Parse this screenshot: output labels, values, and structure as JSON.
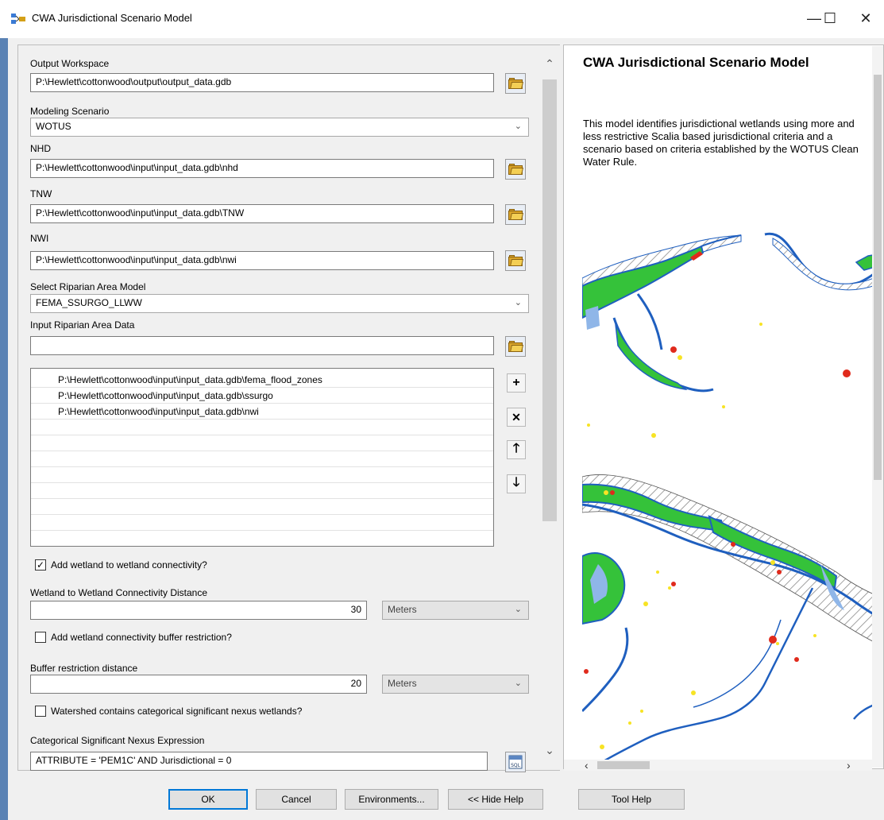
{
  "window": {
    "title": "CWA Jurisdictional Scenario Model",
    "controls": {
      "minimize": "—",
      "maximize": "☐",
      "close": "✕"
    }
  },
  "form": {
    "output_workspace": {
      "label": "Output Workspace",
      "value": "P:\\Hewlett\\cottonwood\\output\\output_data.gdb"
    },
    "modeling_scenario": {
      "label": "Modeling Scenario",
      "value": "WOTUS"
    },
    "nhd": {
      "label": "NHD",
      "value": "P:\\Hewlett\\cottonwood\\input\\input_data.gdb\\nhd"
    },
    "tnw": {
      "label": "TNW",
      "value": "P:\\Hewlett\\cottonwood\\input\\input_data.gdb\\TNW"
    },
    "nwi": {
      "label": "NWI",
      "value": "P:\\Hewlett\\cottonwood\\input\\input_data.gdb\\nwi"
    },
    "riparian_model": {
      "label": "Select Riparian Area Model",
      "value": "FEMA_SSURGO_LLWW"
    },
    "riparian_data": {
      "label": "Input Riparian Area Data",
      "value": "",
      "items": [
        "P:\\Hewlett\\cottonwood\\input\\input_data.gdb\\fema_flood_zones",
        "P:\\Hewlett\\cottonwood\\input\\input_data.gdb\\ssurgo",
        "P:\\Hewlett\\cottonwood\\input\\input_data.gdb\\nwi"
      ]
    },
    "wetland_connectivity": {
      "label": "Add wetland to wetland connectivity?",
      "checked": true
    },
    "connectivity_distance": {
      "label": "Wetland to Wetland Connectivity Distance",
      "value": "30",
      "unit": "Meters"
    },
    "buffer_restriction": {
      "label": "Add wetland connectivity buffer restriction?",
      "checked": false
    },
    "buffer_distance": {
      "label": "Buffer restriction distance",
      "value": "20",
      "unit": "Meters"
    },
    "categorical_wetlands": {
      "label": "Watershed contains categorical significant nexus wetlands?",
      "checked": false
    },
    "nexus_expression": {
      "label": "Categorical Significant Nexus Expression",
      "value": "ATTRIBUTE = 'PEM1C' AND Jurisdictional = 0"
    }
  },
  "help": {
    "title": "CWA Jurisdictional Scenario Model",
    "body": "This model identifies jurisdictional wetlands using more and less restrictive Scalia based jurisdictional criteria and a scenario based on criteria established by the WOTUS Clean Water Rule.",
    "map_colors": {
      "stream": "#1f5fbf",
      "wetland": "#35c23a",
      "water": "#8fb6e8",
      "hotspot": "#e02a1c",
      "highlight": "#f7e324",
      "hatch": "#8a8a8a"
    }
  },
  "buttons": {
    "ok": "OK",
    "cancel": "Cancel",
    "environments": "Environments...",
    "hide_help": "<< Hide Help",
    "tool_help": "Tool Help"
  }
}
